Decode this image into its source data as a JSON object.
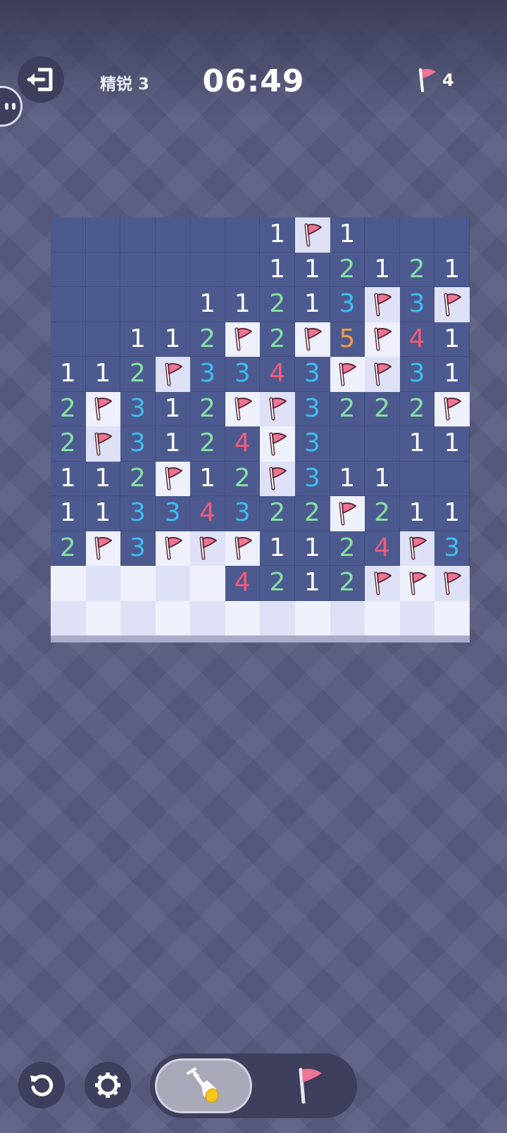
{
  "header": {
    "level_label": "精锐 3",
    "timer": "06:49",
    "flags_remaining": "4"
  },
  "icons": {
    "exit": "exit-icon",
    "flag": "flag-icon",
    "reset": "reset-icon",
    "settings": "gear-icon",
    "shovel": "shovel-icon"
  },
  "toolbar": {
    "mode_selected": "dig"
  },
  "colors": {
    "opened_cell": "#4c5a8f",
    "covered_light": "#eef0fc",
    "covered_dark": "#dee1f5",
    "n1": "#ffffff",
    "n2": "#86e0a5",
    "n3": "#3ebdf2",
    "n4": "#ef5b7d",
    "n5": "#f29a48",
    "flag": "#ee7595"
  },
  "board": {
    "cols": 12,
    "rows": 12,
    "legend": "'' = opened blank, digits = opened number, F = flagged, . = covered",
    "cells": [
      [
        "",
        "",
        "",
        "",
        "",
        "",
        "1",
        "F",
        "1",
        "",
        "",
        ""
      ],
      [
        "",
        "",
        "",
        "",
        "",
        "",
        "1",
        "1",
        "2",
        "1",
        "2",
        "1"
      ],
      [
        "",
        "",
        "",
        "",
        "1",
        "1",
        "2",
        "1",
        "3",
        "F",
        "3",
        "F"
      ],
      [
        "",
        "",
        "1",
        "1",
        "2",
        "F",
        "2",
        "F",
        "5",
        "F",
        "4",
        "1"
      ],
      [
        "1",
        "1",
        "2",
        "F",
        "3",
        "3",
        "4",
        "3",
        "F",
        "F",
        "3",
        "1"
      ],
      [
        "2",
        "F",
        "3",
        "1",
        "2",
        "F",
        "F",
        "3",
        "2",
        "2",
        "2",
        "F"
      ],
      [
        "2",
        "F",
        "3",
        "1",
        "2",
        "4",
        "F",
        "3",
        "",
        "",
        "1",
        "1"
      ],
      [
        "1",
        "1",
        "2",
        "F",
        "1",
        "2",
        "F",
        "3",
        "1",
        "1",
        "",
        ""
      ],
      [
        "1",
        "1",
        "3",
        "3",
        "4",
        "3",
        "2",
        "2",
        "F",
        "2",
        "1",
        "1"
      ],
      [
        "2",
        "F",
        "3",
        "F",
        "F",
        "F",
        "1",
        "1",
        "2",
        "4",
        "F",
        "3"
      ],
      [
        ".",
        ".",
        ".",
        ".",
        ".",
        "4",
        "2",
        "1",
        "2",
        "F",
        "F",
        "F"
      ],
      [
        ".",
        ".",
        ".",
        ".",
        ".",
        ".",
        ".",
        ".",
        ".",
        ".",
        ".",
        "."
      ]
    ]
  }
}
